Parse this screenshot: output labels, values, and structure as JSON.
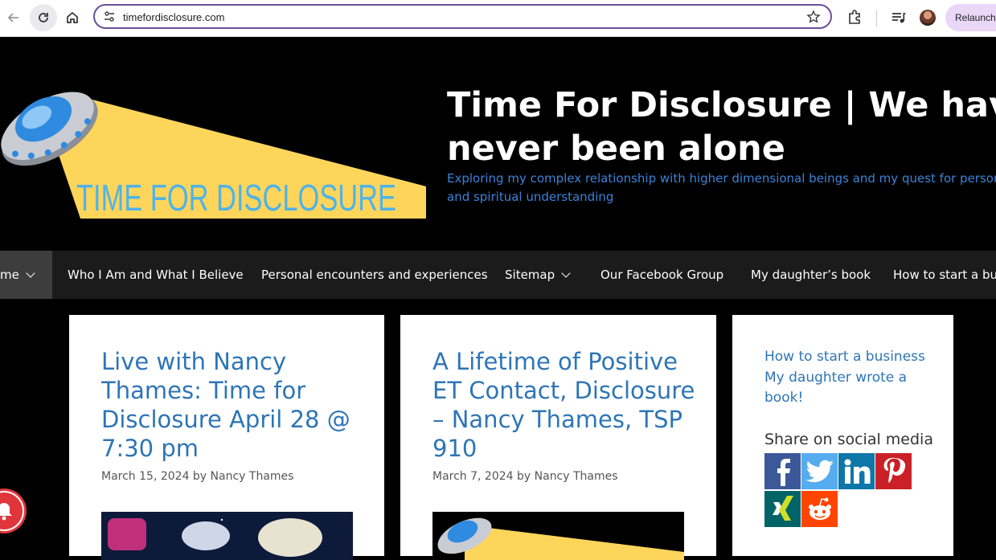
{
  "browser": {
    "url": "timefordisclosure.com",
    "relaunch_label": "Relaunch"
  },
  "header": {
    "logo_text": "TIME FOR DISCLOSURE",
    "site_title_line1": "Time For Disclosure | We have",
    "site_title_line2": "never been alone",
    "tagline_line1": "Exploring my complex relationship with higher dimensional beings and my quest for personal grow",
    "tagline_line2": "and spiritual understanding"
  },
  "nav": {
    "items": [
      {
        "label": "me",
        "has_dropdown": true,
        "active": true
      },
      {
        "label": "Who I Am and What I Believe",
        "has_dropdown": false
      },
      {
        "label": "Personal encounters and experiences",
        "has_dropdown": false
      },
      {
        "label": "Sitemap",
        "has_dropdown": true
      },
      {
        "label": "Our Facebook Group",
        "has_dropdown": false
      },
      {
        "label": "My daughter’s book",
        "has_dropdown": false
      },
      {
        "label": "How to start a bus",
        "has_dropdown": false
      }
    ]
  },
  "posts": [
    {
      "title": "Live with Nancy Thames: Time for Disclosure April 28 @ 7:30 pm",
      "title_lines": [
        "Live with Nancy",
        "Thames: Time for",
        "Disclosure April 28 @",
        "7:30 pm"
      ],
      "meta": "March 15, 2024 by Nancy Thames"
    },
    {
      "title": "A Lifetime of Positive ET Contact, Disclosure – Nancy Thames, TSP 910",
      "title_lines": [
        "A Lifetime of Positive",
        "ET Contact, Disclosure",
        "– Nancy Thames, TSP",
        "910"
      ],
      "meta": "March 7, 2024 by Nancy Thames"
    }
  ],
  "sidebar": {
    "links": [
      "How to start a business",
      "My daughter wrote a book!"
    ],
    "share_heading": "Share on social media",
    "social": [
      {
        "name": "facebook",
        "color": "#3b5998"
      },
      {
        "name": "twitter",
        "color": "#55acee"
      },
      {
        "name": "linkedin",
        "color": "#0e76a8"
      },
      {
        "name": "pinterest",
        "color": "#cb2027"
      },
      {
        "name": "xing",
        "color": "#026466"
      },
      {
        "name": "reddit",
        "color": "#ff4500"
      }
    ]
  },
  "colors": {
    "link_blue": "#2e75b6",
    "tagline_blue": "#3b83d8",
    "nav_bg": "#1b1b1b",
    "logo_beam": "#fdd55b"
  }
}
